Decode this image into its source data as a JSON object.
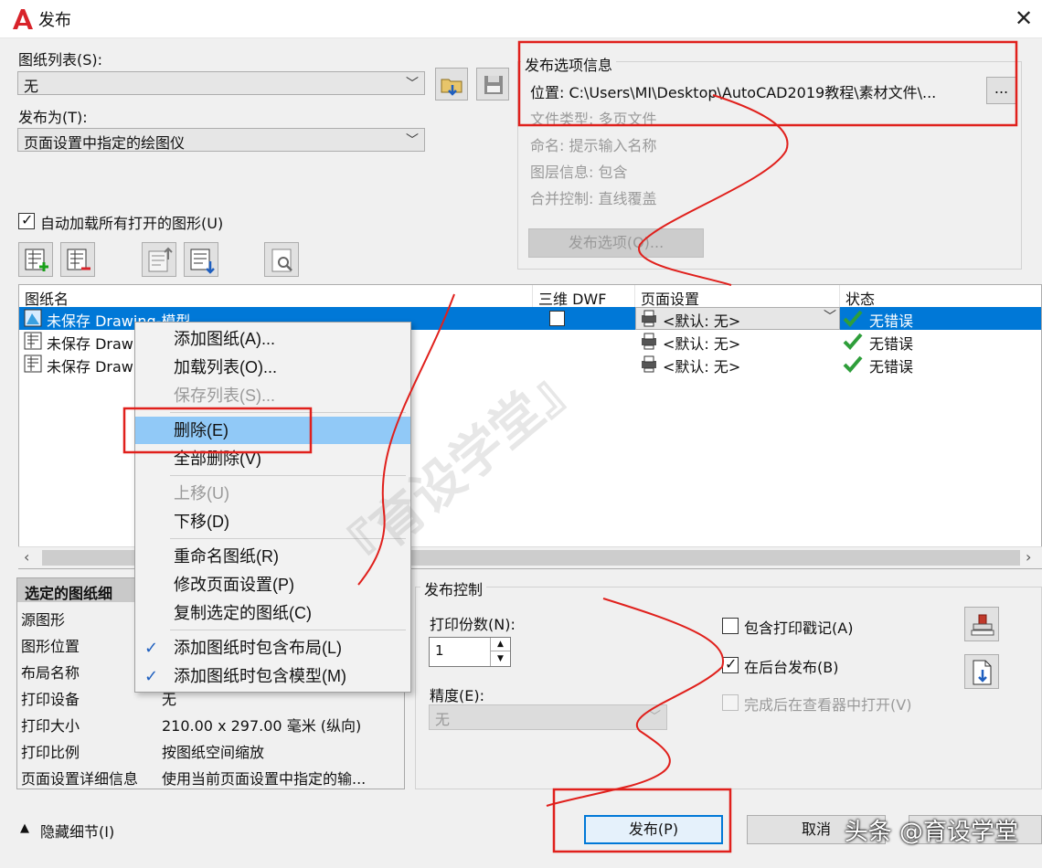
{
  "window": {
    "title": "发布"
  },
  "sheet_list": {
    "label": "图纸列表(S):",
    "value": "无"
  },
  "publish_to": {
    "label": "发布为(T):",
    "value": "页面设置中指定的绘图仪"
  },
  "publish_options_info": {
    "title": "发布选项信息",
    "location": "位置: C:\\Users\\MI\\Desktop\\AutoCAD2019教程\\素材文件\\...",
    "browse_label": "...",
    "file_type": "文件类型: 多页文件",
    "naming": "命名: 提示输入名称",
    "layer_info": "图层信息: 包含",
    "merge_control": "合并控制: 直线覆盖",
    "options_button": "发布选项(O)..."
  },
  "auto_load": {
    "label": "自动加载所有打开的图形(U)",
    "checked": true
  },
  "sheet_table": {
    "headers": [
      "图纸名",
      "三维 DWF",
      "页面设置",
      "状态"
    ],
    "rows": [
      {
        "name": "未保存 Drawing-模型",
        "page_setup": "<默认: 无>",
        "status": "无错误",
        "selected": true
      },
      {
        "name": "未保存 Drawi",
        "page_setup": "<默认: 无>",
        "status": "无错误",
        "selected": false
      },
      {
        "name": "未保存 Drawi",
        "page_setup": "<默认: 无>",
        "status": "无错误",
        "selected": false
      }
    ]
  },
  "context_menu": {
    "items": [
      {
        "label": "添加图纸(A)...",
        "enabled": true
      },
      {
        "label": "加载列表(O)...",
        "enabled": true
      },
      {
        "label": "保存列表(S)...",
        "enabled": false
      },
      {
        "label": "删除(E)",
        "enabled": true,
        "highlighted": true
      },
      {
        "label": "全部删除(V)",
        "enabled": true
      },
      {
        "label": "上移(U)",
        "enabled": false
      },
      {
        "label": "下移(D)",
        "enabled": true
      },
      {
        "label": "重命名图纸(R)",
        "enabled": true
      },
      {
        "label": "修改页面设置(P)",
        "enabled": true
      },
      {
        "label": "复制选定的图纸(C)",
        "enabled": true
      },
      {
        "label": "添加图纸时包含布局(L)",
        "enabled": true,
        "checked": true
      },
      {
        "label": "添加图纸时包含模型(M)",
        "enabled": true,
        "checked": true
      }
    ]
  },
  "details": {
    "title": "选定的图纸细",
    "rows": [
      {
        "key": "源图形",
        "value": ""
      },
      {
        "key": "图形位置",
        "value": ""
      },
      {
        "key": "布局名称",
        "value": ""
      },
      {
        "key": "打印设备",
        "value": "无"
      },
      {
        "key": "打印大小",
        "value": "210.00 x 297.00 毫米 (纵向)"
      },
      {
        "key": "打印比例",
        "value": "按图纸空间缩放"
      },
      {
        "key": "页面设置详细信息",
        "value": "使用当前页面设置中指定的输..."
      }
    ]
  },
  "publish_control": {
    "title": "发布控制",
    "copies_label": "打印份数(N):",
    "copies_value": "1",
    "precision_label": "精度(E):",
    "precision_value": "无",
    "include_stamp": {
      "label": "包含打印戳记(A)",
      "checked": false
    },
    "background_publish": {
      "label": "在后台发布(B)",
      "checked": true
    },
    "open_in_viewer": {
      "label": "完成后在查看器中打开(V)",
      "checked": false,
      "enabled": false
    }
  },
  "footer": {
    "hide_details": "隐藏细节(I)",
    "publish_button": "发布(P)",
    "cancel_button": "取消"
  },
  "overlay_text": {
    "toutiao_watermark": "头条 @育设学堂",
    "diagonal_watermark": "『育设学堂』"
  },
  "colors": {
    "selection": "#0078d7",
    "menu_highlight": "#91c9f7",
    "annotation_red": "#e0201c",
    "check_green": "#2e9e3a"
  }
}
